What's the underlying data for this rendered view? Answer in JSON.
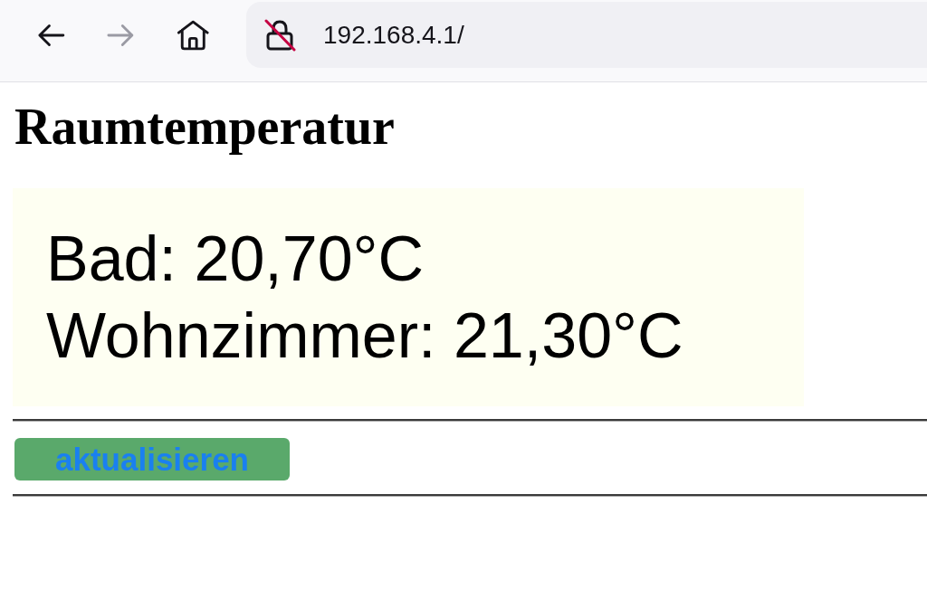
{
  "browser": {
    "nav_buttons": [
      {
        "kind": "back",
        "disabled": false
      },
      {
        "kind": "forward",
        "disabled": true
      },
      {
        "kind": "home",
        "disabled": false
      }
    ],
    "address_bar": {
      "secure": false,
      "url": "192.168.4.1/"
    }
  },
  "page": {
    "heading": "Raumtemperatur",
    "readings": [
      "Bad: 20,70°C",
      "Wohnzimmer: 21,30°C"
    ],
    "button": "aktualisieren"
  }
}
